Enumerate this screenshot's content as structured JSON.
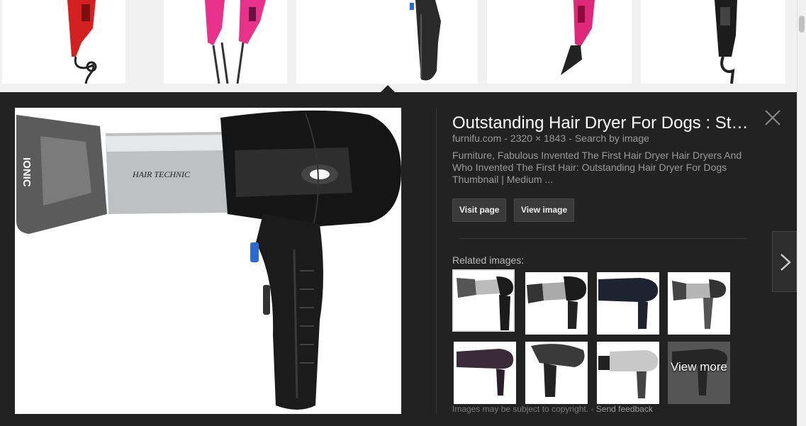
{
  "panel": {
    "title": "Outstanding Hair Dryer For Dogs : St…",
    "domain": "furnifu.com",
    "dimensions": "2320 × 1843",
    "separator": "-",
    "search_by_image": "Search by image",
    "description": "Furniture, Fabulous Invented The First Hair Dryer Hair Dryers And Who Invented The First Hair: Outstanding Hair Dryer For Dogs Thumbnail | Medium ...",
    "visit_page_label": "Visit page",
    "view_image_label": "View image",
    "related_label": "Related images:",
    "view_more_label": "View more",
    "copyright_text": "Images may be subject to copyright.",
    "footer_separator": "-",
    "send_feedback_label": "Send feedback"
  },
  "main_image": {
    "brand_text": "IONIC",
    "logo_text": "HAIR TECHNIC"
  },
  "icons": {
    "close": "close-icon",
    "next": "chevron-right-icon"
  },
  "colors": {
    "panel_bg": "#222222",
    "button_bg": "#3a3a3a",
    "text_muted": "#9a9a9a"
  }
}
